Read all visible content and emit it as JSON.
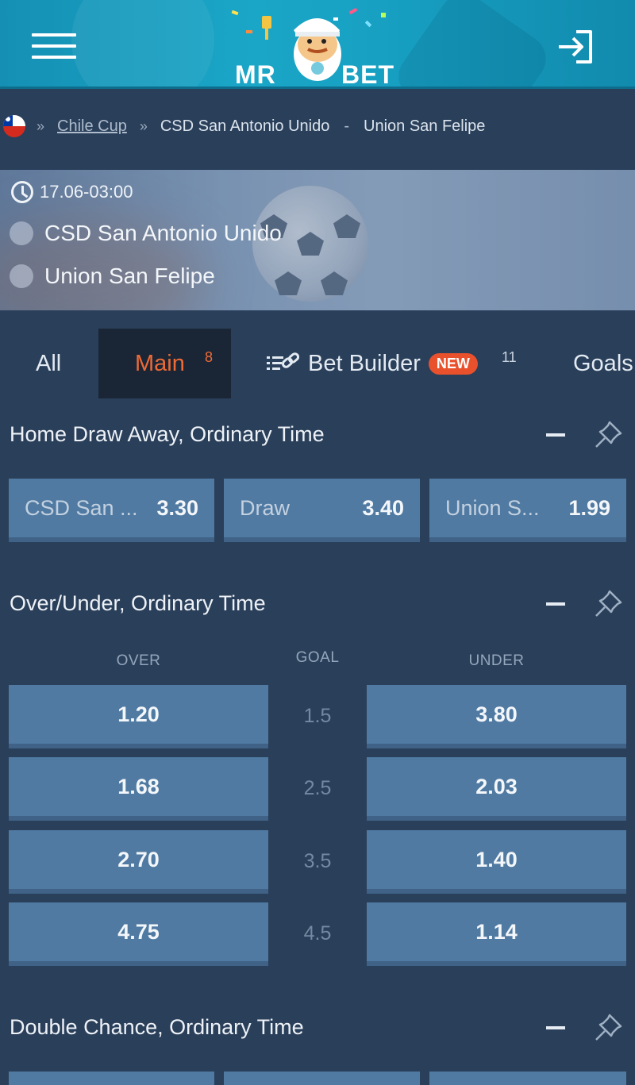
{
  "header": {
    "logo_left": "MR",
    "logo_right": "BET",
    "menu_icon": "hamburger-menu-icon",
    "login_icon": "login-arrow-icon"
  },
  "breadcrumb": {
    "flag": "chile-flag-icon",
    "separator": "»",
    "league": "Chile Cup",
    "home": "CSD San Antonio Unido",
    "dash": "-",
    "away": "Union San Felipe"
  },
  "match": {
    "datetime": "17.06-03:00",
    "home_team": "CSD San Antonio Unido",
    "away_team": "Union San Felipe"
  },
  "tabs": {
    "all": "All",
    "main": "Main",
    "main_count": "8",
    "bet_builder": "Bet Builder",
    "new_badge": "NEW",
    "bet_builder_count": "11",
    "goals": "Goals"
  },
  "markets": {
    "hda": {
      "title": "Home Draw Away, Ordinary Time",
      "options": [
        {
          "label": "CSD San ...",
          "odd": "3.30"
        },
        {
          "label": "Draw",
          "odd": "3.40"
        },
        {
          "label": "Union S...",
          "odd": "1.99"
        }
      ]
    },
    "ou": {
      "title": "Over/Under, Ordinary Time",
      "col_over": "OVER",
      "col_goal": "GOAL",
      "col_under": "UNDER",
      "rows": [
        {
          "over": "1.20",
          "goal": "1.5",
          "under": "3.80"
        },
        {
          "over": "1.68",
          "goal": "2.5",
          "under": "2.03"
        },
        {
          "over": "2.70",
          "goal": "3.5",
          "under": "1.40"
        },
        {
          "over": "4.75",
          "goal": "4.5",
          "under": "1.14"
        }
      ]
    },
    "dc": {
      "title": "Double Chance, Ordinary Time"
    }
  },
  "colors": {
    "background": "#2a3f5a",
    "button": "#507aa2",
    "accent": "#ee6a35",
    "header": "#1aa6c7"
  }
}
